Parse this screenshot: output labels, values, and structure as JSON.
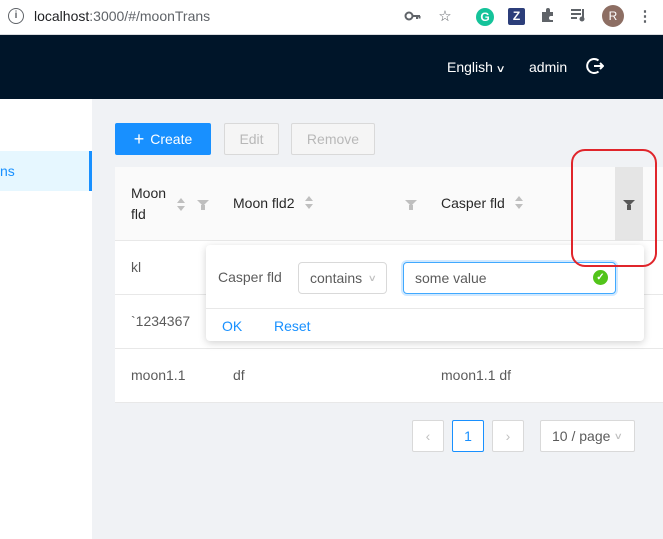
{
  "browser": {
    "url_host": "localhost",
    "url_path": ":3000/#/moonTrans"
  },
  "header": {
    "language": "English",
    "user": "admin"
  },
  "sidebar": {
    "active_item": "ns"
  },
  "toolbar": {
    "create_label": "Create",
    "edit_label": "Edit",
    "remove_label": "Remove"
  },
  "table": {
    "columns": [
      {
        "label_line1": "Moon",
        "label_line2": "fld"
      },
      {
        "label": "Moon fld2"
      },
      {
        "label": "Casper fld"
      }
    ],
    "rows": [
      {
        "c1": "kl",
        "c2": "",
        "c3": ""
      },
      {
        "c1": "`1234367",
        "c2": "",
        "c3": ""
      },
      {
        "c1": "moon1.1",
        "c2": "df",
        "c3": "moon1.1 df"
      }
    ]
  },
  "pagination": {
    "current_page": "1",
    "page_size": "10 / page"
  },
  "filter_dropdown": {
    "field": "Casper fld",
    "operator": "contains",
    "value": "some value",
    "ok_label": "OK",
    "reset_label": "Reset"
  },
  "colors": {
    "primary": "#1890ff",
    "header_bg": "#001529",
    "annotation": "#e0252b",
    "success": "#52c41a"
  }
}
